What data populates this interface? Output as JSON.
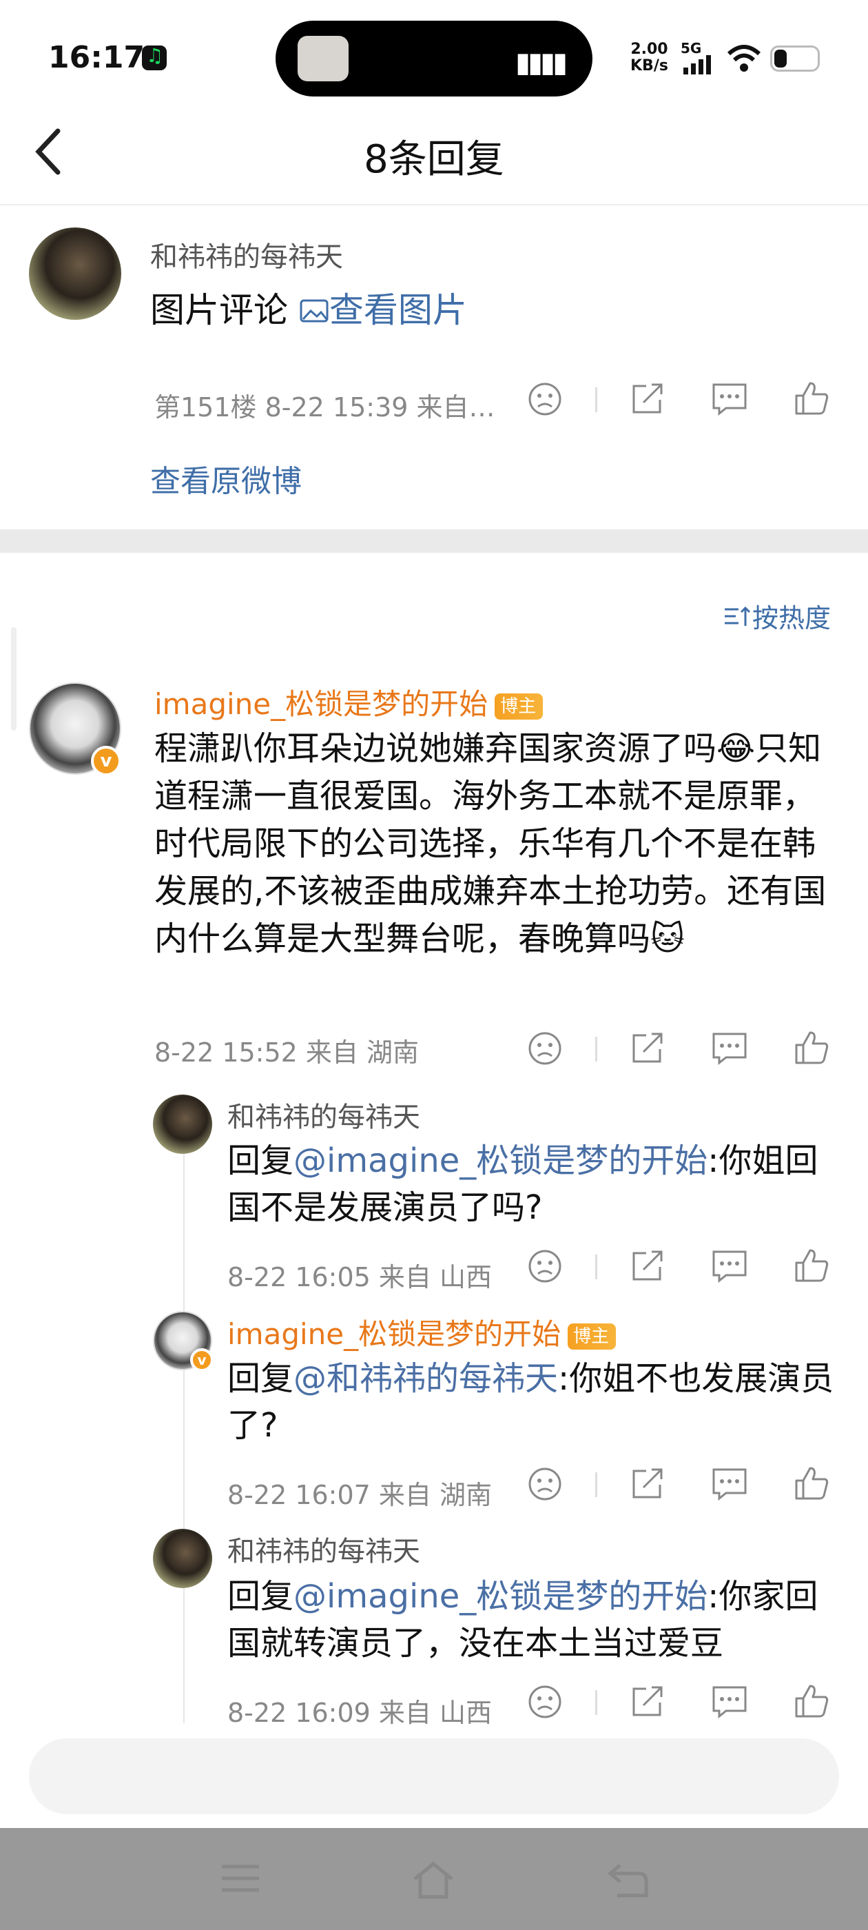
{
  "status_bar": {
    "time": "16:17",
    "net_speed_value": "2.00",
    "net_speed_unit": "KB/s",
    "network": "5G"
  },
  "header": {
    "title": "8条回复"
  },
  "original_comment": {
    "username": "和祎祎的每祎天",
    "text": "图片评论",
    "image_link": "查看图片",
    "meta": "第151楼 8-22 15:39  来自…",
    "view_original": "查看原微博"
  },
  "sort": {
    "label": "按热度"
  },
  "main_comment": {
    "username": "imagine_松锁是梦的开始",
    "badge": "博主",
    "text": "程潇趴你耳朵边说她嫌弃国家资源了吗😂只知道程潇一直很爱国。海外务工本就不是原罪，时代局限下的公司选择，乐华有几个不是在韩发展的,不该被歪曲成嫌弃本土抢功劳。还有国内什么算是大型舞台呢，春晚算吗🐱",
    "meta": "8-22 15:52  来自 湖南"
  },
  "replies": [
    {
      "username": "和祎祎的每祎天",
      "badge": "",
      "prefix": "回复",
      "mention": "@imagine_松锁是梦的开始",
      "text": ":你姐回国不是发展演员了吗?",
      "meta": "8-22 16:05  来自 山西"
    },
    {
      "username": "imagine_松锁是梦的开始",
      "badge": "博主",
      "prefix": "回复",
      "mention": "@和祎祎的每祎天",
      "text": ":你姐不也发展演员了?",
      "meta": "8-22 16:07  来自 湖南"
    },
    {
      "username": "和祎祎的每祎天",
      "badge": "",
      "prefix": "回复",
      "mention": "@imagine_松锁是梦的开始",
      "text": ":你家回国就转演员了，没在本土当过爱豆",
      "meta": "8-22 16:09  来自 山西"
    }
  ],
  "icons": [
    "back-icon",
    "unhappy-icon",
    "share-icon",
    "comment-icon",
    "like-icon",
    "sort-icon",
    "image-icon",
    "menu-icon",
    "home-icon",
    "return-icon"
  ],
  "colors": {
    "orange_name": "#e8781a",
    "link_blue": "#3f6ea8",
    "mention_blue": "#4a6fa5"
  }
}
